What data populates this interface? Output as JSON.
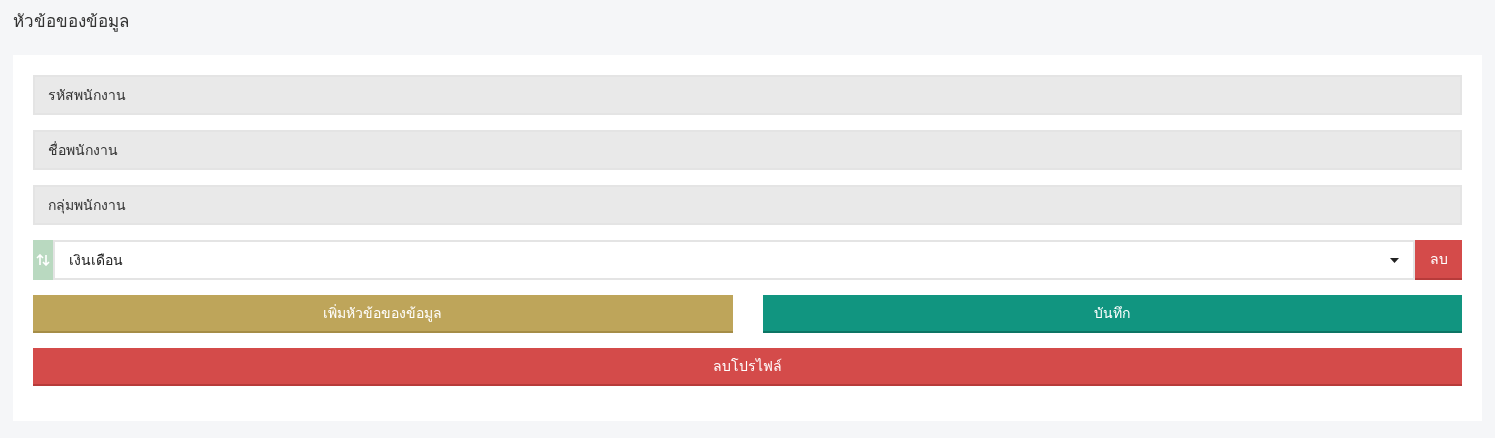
{
  "title": "หัวข้อของข้อมูล",
  "fields": [
    {
      "value": "รหัสพนักงาน",
      "disabled": true
    },
    {
      "value": "ชื่อพนักงาน",
      "disabled": true
    },
    {
      "value": "กลุ่มพนักงาน",
      "disabled": true
    }
  ],
  "sortable_row": {
    "select_value": "เงินเดือน",
    "delete_label": "ลบ"
  },
  "buttons": [
    {
      "label": "เพิ่มหัวข้อของข้อมูล",
      "kind": "add"
    },
    {
      "label": "บันทึก",
      "kind": "save"
    }
  ],
  "delete_profile_button": {
    "label": "ลบโปรไฟล์"
  }
}
